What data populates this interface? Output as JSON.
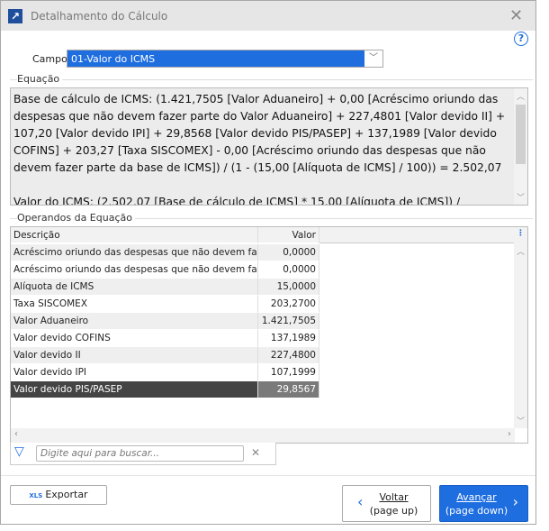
{
  "window": {
    "title": "Detalhamento do Cálculo",
    "close_icon": "close-icon",
    "help_icon": "?"
  },
  "campo": {
    "label": "Campo",
    "value": "01-Valor do ICMS"
  },
  "equacao": {
    "legend": "Equação",
    "text": "Base de cálculo de ICMS: (1.421,7505 [Valor Aduaneiro] + 0,00 [Acréscimo oriundo das despesas que não devem fazer parte do Valor Aduaneiro] + 227,4801 [Valor devido II] + 107,20 [Valor devido IPI] + 29,8568 [Valor devido PIS/PASEP] + 137,1989 [Valor devido COFINS] + 203,27 [Taxa SISCOMEX] - 0,00 [Acréscimo oriundo das despesas que não devem fazer parte da base de ICMS]) / (1 - (15,00 [Alíquota de ICMS] / 100)) = 2.502,07\n\nValor do ICMS: (2.502,07 [Base de cálculo de ICMS] * 15,00 [Alíquota de ICMS]) /"
  },
  "operandos": {
    "legend": "Operandos da Equação",
    "columns": [
      "Descrição",
      "Valor"
    ],
    "rows": [
      {
        "desc": "Acréscimo oriundo das despesas que não devem fazer",
        "valor": "0,0000"
      },
      {
        "desc": "Acréscimo oriundo das despesas que não devem fazer",
        "valor": "0,0000"
      },
      {
        "desc": "Alíquota de ICMS",
        "valor": "15,0000"
      },
      {
        "desc": "Taxa SISCOMEX",
        "valor": "203,2700"
      },
      {
        "desc": "Valor Aduaneiro",
        "valor": "1.421,7505"
      },
      {
        "desc": "Valor devido COFINS",
        "valor": "137,1989"
      },
      {
        "desc": "Valor devido II",
        "valor": "227,4800"
      },
      {
        "desc": "Valor devido IPI",
        "valor": "107,1999"
      },
      {
        "desc": "Valor devido PIS/PASEP",
        "valor": "29,8567"
      }
    ],
    "selected_index": 8,
    "search_placeholder": "Digite aqui para buscar..."
  },
  "buttons": {
    "exportar": "Exportar",
    "xls": "XLS",
    "voltar": "Voltar",
    "voltar_hint": "(page up)",
    "avancar": "Avançar",
    "avancar_hint": "(page down)"
  },
  "colors": {
    "accent": "#1e6ee0",
    "selected_row": "#444444"
  }
}
